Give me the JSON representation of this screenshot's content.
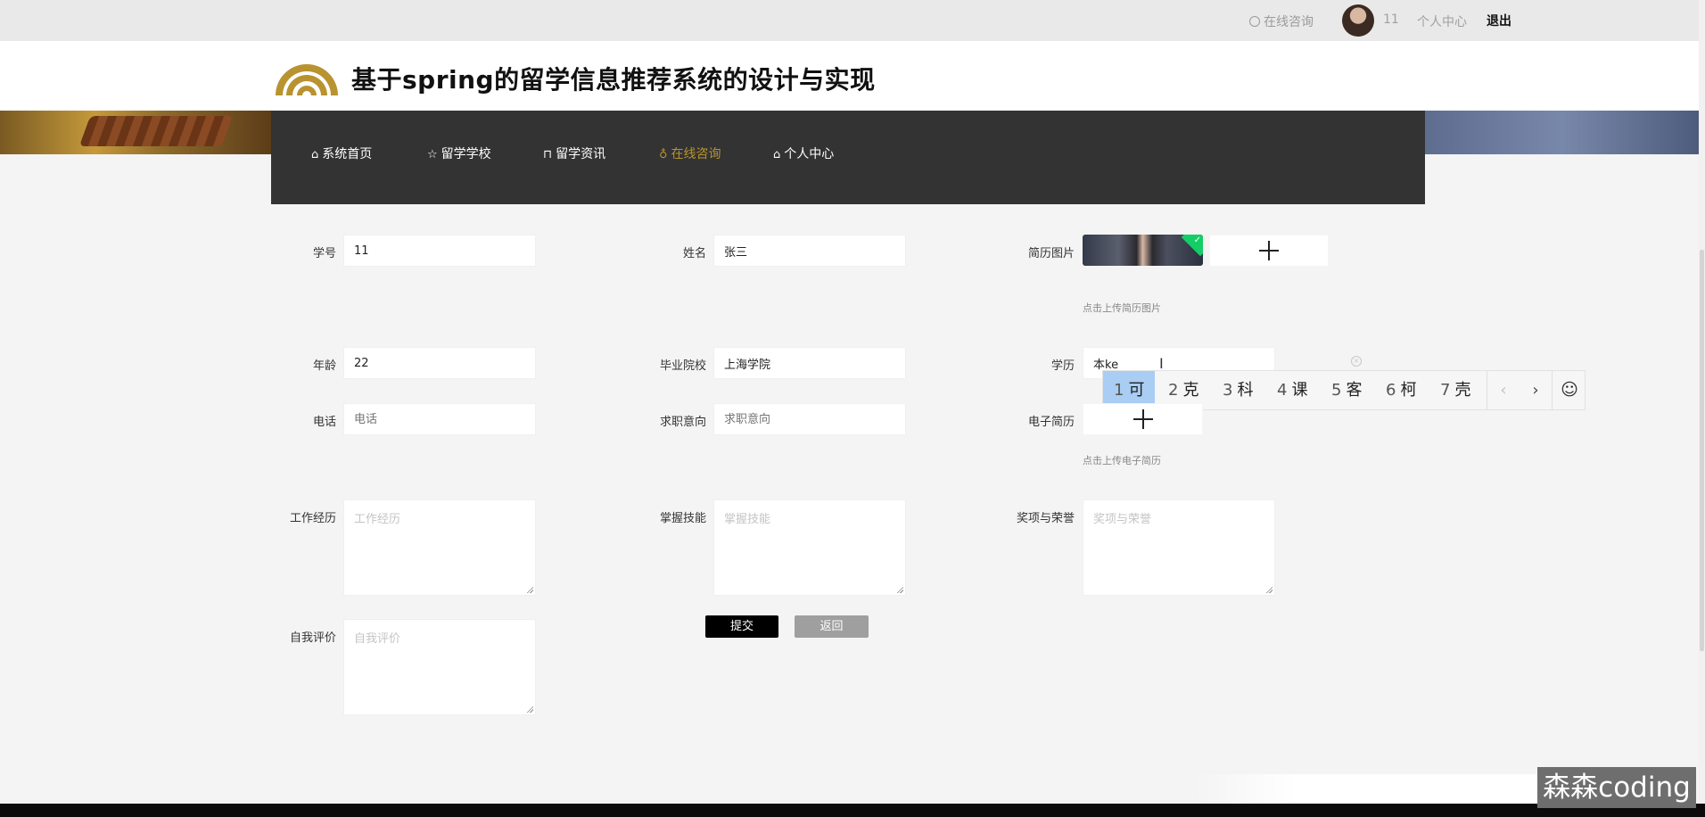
{
  "topbar": {
    "consult_label": "在线咨询",
    "username": "11",
    "user_center": "个人中心",
    "logout": "退出"
  },
  "header": {
    "title": "基于spring的留学信息推荐系统的设计与实现",
    "logo_color": "#b8932f"
  },
  "nav": [
    {
      "label": "系统首页",
      "icon": "home-icon"
    },
    {
      "label": "留学学校",
      "icon": "star-icon"
    },
    {
      "label": "留学资讯",
      "icon": "bag-icon"
    },
    {
      "label": "在线咨询",
      "icon": "bell-icon",
      "active": true
    },
    {
      "label": "个人中心",
      "icon": "home-icon"
    }
  ],
  "form": {
    "student_id": {
      "label": "学号",
      "value": "11"
    },
    "name": {
      "label": "姓名",
      "value": "张三"
    },
    "resume_photo": {
      "label": "简历图片",
      "hint": "点击上传简历图片"
    },
    "age": {
      "label": "年龄",
      "value": "22"
    },
    "school": {
      "label": "毕业院校",
      "value": "上海学院"
    },
    "education": {
      "label": "学历",
      "value": "本ke"
    },
    "phone": {
      "label": "电话",
      "placeholder": "电话"
    },
    "intention": {
      "label": "求职意向",
      "placeholder": "求职意向"
    },
    "e_resume": {
      "label": "电子简历",
      "hint": "点击上传电子简历"
    },
    "work_exp": {
      "label": "工作经历",
      "placeholder": "工作经历"
    },
    "skills": {
      "label": "掌握技能",
      "placeholder": "掌握技能"
    },
    "awards": {
      "label": "奖项与荣誉",
      "placeholder": "奖项与荣誉"
    },
    "self_eval": {
      "label": "自我评价",
      "placeholder": "自我评价"
    },
    "submit": "提交",
    "back": "返回"
  },
  "ime": {
    "candidates": [
      {
        "n": "1",
        "c": "可"
      },
      {
        "n": "2",
        "c": "克"
      },
      {
        "n": "3",
        "c": "科"
      },
      {
        "n": "4",
        "c": "课"
      },
      {
        "n": "5",
        "c": "客"
      },
      {
        "n": "6",
        "c": "柯"
      },
      {
        "n": "7",
        "c": "壳"
      }
    ],
    "prev": "‹",
    "next": "›",
    "emoji": "☺"
  },
  "watermark": "森森coding"
}
